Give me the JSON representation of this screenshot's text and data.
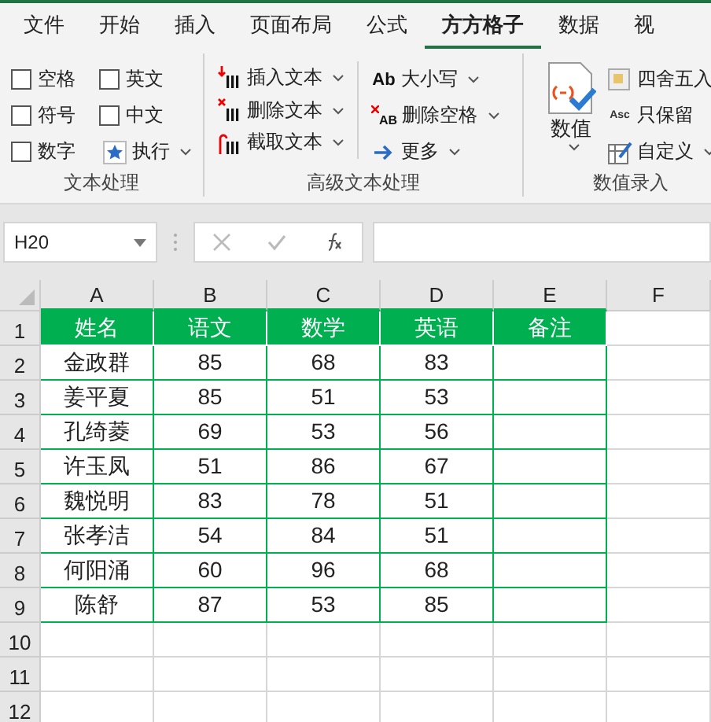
{
  "tabs": [
    {
      "label": "文件",
      "selected": false
    },
    {
      "label": "开始",
      "selected": false
    },
    {
      "label": "插入",
      "selected": false
    },
    {
      "label": "页面布局",
      "selected": false
    },
    {
      "label": "公式",
      "selected": false
    },
    {
      "label": "方方格子",
      "selected": true
    },
    {
      "label": "数据",
      "selected": false
    },
    {
      "label": "视",
      "selected": false
    }
  ],
  "text_group": {
    "checkboxes": [
      {
        "label": "空格",
        "checked": false
      },
      {
        "label": "符号",
        "checked": false
      },
      {
        "label": "数字",
        "checked": false
      },
      {
        "label": "英文",
        "checked": false
      },
      {
        "label": "中文",
        "checked": false
      }
    ],
    "execute_button": "执行",
    "label": "文本处理"
  },
  "advanced_group": {
    "columns": [
      [
        {
          "label": "插入文本",
          "kind": "insert"
        },
        {
          "label": "删除文本",
          "kind": "delete"
        },
        {
          "label": "截取文本",
          "kind": "extract"
        }
      ],
      [
        {
          "label": "大小写",
          "kind": "case",
          "icon_text": "Ab"
        },
        {
          "label": "删除空格",
          "kind": "space",
          "icon_text": "AB"
        },
        {
          "label": "更多",
          "kind": "more"
        }
      ]
    ],
    "label": "高级文本处理"
  },
  "value_group": {
    "big_button": "数值",
    "buttons": [
      {
        "label": "四舍五入",
        "kind": "round"
      },
      {
        "label": "只保留",
        "kind": "keep",
        "icon_text": "Asc"
      },
      {
        "label": "自定义",
        "kind": "custom",
        "dropdown": true
      }
    ],
    "label": "数值录入"
  },
  "formula_bar": {
    "name_box": "H20"
  },
  "sheet": {
    "columns": [
      "A",
      "B",
      "C",
      "D",
      "E",
      "F"
    ],
    "rows": [
      {
        "number": "1",
        "kind": "header",
        "cells": [
          "姓名",
          "语文",
          "数学",
          "英语",
          "备注"
        ]
      },
      {
        "number": "2",
        "kind": "data",
        "cells": [
          "金政群",
          "85",
          "68",
          "83"
        ]
      },
      {
        "number": "3",
        "kind": "data",
        "cells": [
          "姜平夏",
          "85",
          "51",
          "53"
        ]
      },
      {
        "number": "4",
        "kind": "data",
        "cells": [
          "孔绮菱",
          "69",
          "53",
          "56"
        ]
      },
      {
        "number": "5",
        "kind": "data",
        "cells": [
          "许玉凤",
          "51",
          "86",
          "67"
        ]
      },
      {
        "number": "6",
        "kind": "data",
        "cells": [
          "魏悦明",
          "83",
          "78",
          "51"
        ]
      },
      {
        "number": "7",
        "kind": "data",
        "cells": [
          "张孝洁",
          "54",
          "84",
          "51"
        ]
      },
      {
        "number": "8",
        "kind": "data",
        "cells": [
          "何阳涌",
          "60",
          "96",
          "68"
        ]
      },
      {
        "number": "9",
        "kind": "data",
        "cells": [
          "陈舒",
          "87",
          "53",
          "85"
        ]
      },
      {
        "number": "10",
        "kind": "empty"
      },
      {
        "number": "11",
        "kind": "empty"
      },
      {
        "number": "12",
        "kind": "empty"
      }
    ]
  }
}
